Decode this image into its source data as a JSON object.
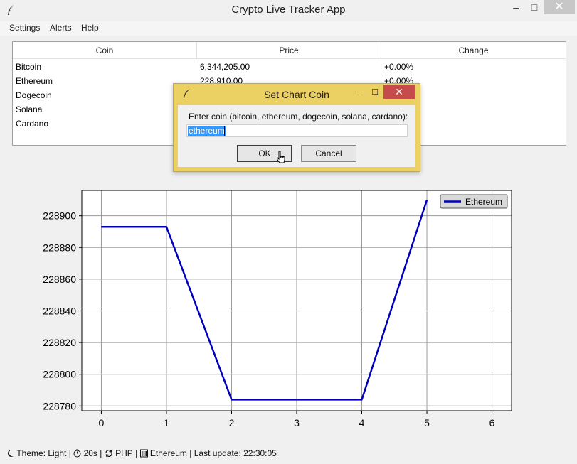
{
  "window": {
    "title": "Crypto Live Tracker App"
  },
  "menu": [
    "Settings",
    "Alerts",
    "Help"
  ],
  "table": {
    "headers": [
      "Coin",
      "Price",
      "Change"
    ],
    "rows": [
      {
        "coin": "Bitcoin",
        "price": "6,344,205.00",
        "change": "+0.00%"
      },
      {
        "coin": "Ethereum",
        "price": "228,910.00",
        "change": "+0.00%"
      },
      {
        "coin": "Dogecoin",
        "price": "",
        "change": ""
      },
      {
        "coin": "Solana",
        "price": "",
        "change": ""
      },
      {
        "coin": "Cardano",
        "price": "",
        "change": ""
      }
    ]
  },
  "dialog": {
    "title": "Set Chart Coin",
    "prompt": "Enter coin (bitcoin, ethereum, dogecoin, solana, cardano):",
    "input_value": "ethereum",
    "ok_label": "OK",
    "cancel_label": "Cancel"
  },
  "status": {
    "theme": "Theme: Light",
    "interval": "20s",
    "currency": "PHP",
    "coin": "Ethereum",
    "last_update": "Last update: 22:30:05",
    "sep": "|"
  },
  "colors": {
    "line": "#0000bb",
    "dialog_frame": "#ebd063",
    "close": "#c74b4b",
    "selection": "#3399ff"
  },
  "chart_data": {
    "type": "line",
    "x": [
      0,
      1,
      2,
      3,
      4,
      5
    ],
    "series": [
      {
        "name": "Ethereum",
        "values": [
          228893,
          228893,
          228784,
          228784,
          228784,
          228910
        ]
      }
    ],
    "xlim": [
      -0.3,
      6.3
    ],
    "ylim": [
      228777,
      228916
    ],
    "xticks": [
      0,
      1,
      2,
      3,
      4,
      5,
      6
    ],
    "yticks": [
      228780,
      228800,
      228820,
      228840,
      228860,
      228880,
      228900
    ],
    "grid": true,
    "legend": "top-right"
  }
}
